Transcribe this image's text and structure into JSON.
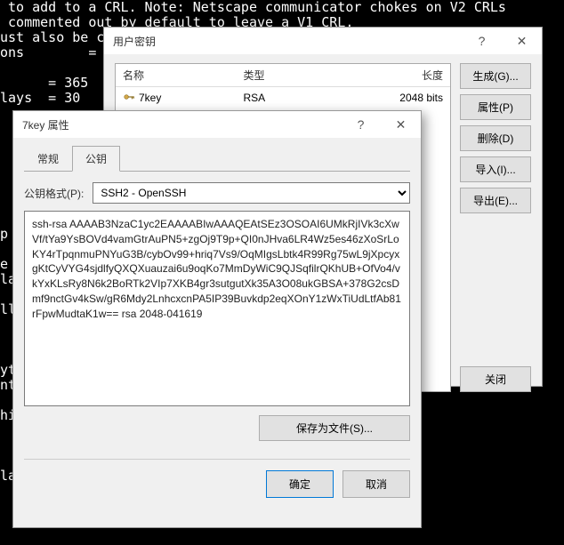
{
  "terminal_lines": [
    " to add to a CRL. Note: Netscape communicator chokes on V2 CRLs",
    " commented out by default to leave a V1 CRL.",
    "ust also be c",
    "ons        =",
    "",
    "      = 365",
    "lays  = 30",
    "",
    "",
    "",
    "",
    "",
    "",
    "",
    "",
    "p",
    "",
    "e",
    "la",
    "",
    "ll",
    "",
    "",
    "",
    "yt",
    "nt",
    "",
    "hi",
    "",
    "",
    "",
    "lame       = optional"
  ],
  "back": {
    "title": "用户密钥",
    "columns": [
      "名称",
      "类型",
      "长度"
    ],
    "row": {
      "name": "7key",
      "type": "RSA",
      "length": "2048 bits"
    },
    "buttons": {
      "generate": "生成(G)...",
      "properties": "属性(P)",
      "delete": "删除(D)",
      "import": "导入(I)...",
      "export": "导出(E)...",
      "close": "关闭"
    }
  },
  "front": {
    "title": "7key 属性",
    "tabs": {
      "general": "常规",
      "pubkey": "公钥"
    },
    "format_label": "公钥格式(P):",
    "format_value": "SSH2 - OpenSSH",
    "key_text": "ssh-rsa AAAAB3NzaC1yc2EAAAABIwAAAQEAtSEz3OSOAI6UMkRjIVk3cXwVf/tYa9YsBOVd4vamGtrAuPN5+zgOj9T9p+QI0nJHva6LR4Wz5es46zXoSrLoKY4rTpqnmuPNYuG3B/cybOv99+hriq7Vs9/OqMIgsLbtk4R99Rg75wL9jXpcyxgKtCyVYG4sjdlfyQXQXuauzai6u9oqKo7MmDyWiC9QJSqfilrQKhUB+OfVo4/vkYxKLsRy8N6k2BoRTk2VIp7XKB4gr3sutgutXk35A3O08ukGBSA+378G2csDmf9nctGv4kSw/gR6Mdy2LnhcxcnPA5IP39Buvkdp2eqXOnY1zWxTiUdLtfAb81rFpwMudtaK1w== rsa 2048-041619",
    "save_as": "保存为文件(S)...",
    "ok": "确定",
    "cancel": "取消"
  }
}
